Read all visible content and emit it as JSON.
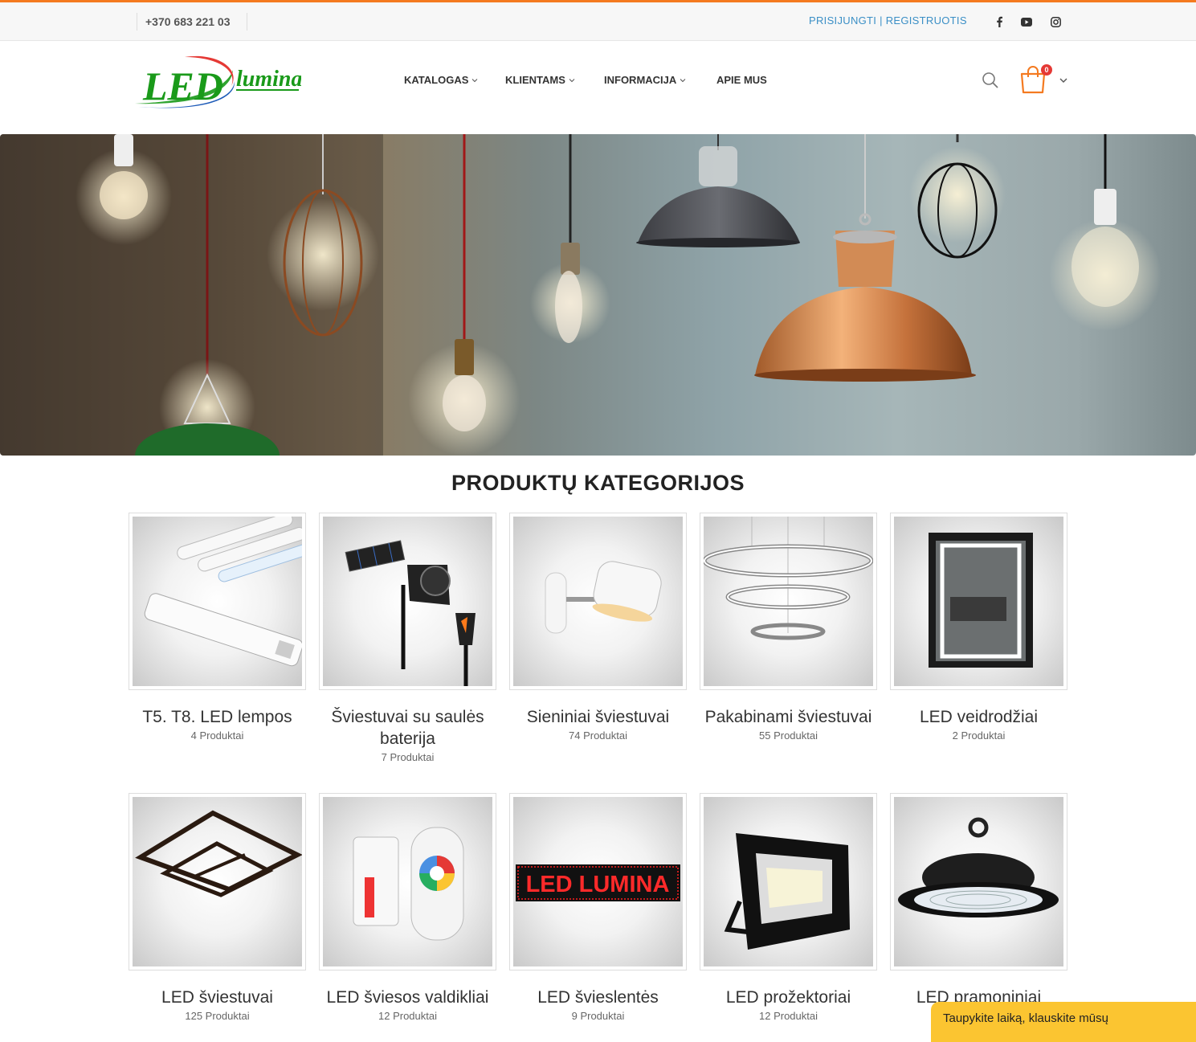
{
  "topbar": {
    "phone": "+370 683 221 03",
    "auth": "PRISIJUNGTI | REGISTRUOTIS",
    "social": [
      "facebook-icon",
      "youtube-icon",
      "instagram-icon"
    ]
  },
  "header": {
    "logo_text_led": "LED",
    "logo_text_lumina": "lumina",
    "nav": [
      {
        "label": "KATALOGAS",
        "has_dropdown": true
      },
      {
        "label": "KLIENTAMS",
        "has_dropdown": true
      },
      {
        "label": "INFORMACIJA",
        "has_dropdown": true
      },
      {
        "label": "APIE MUS",
        "has_dropdown": false
      }
    ],
    "cart_count": "0"
  },
  "section": {
    "title": "PRODUKTŲ KATEGORIJOS"
  },
  "categories": [
    {
      "name": "T5. T8. LED lempos",
      "count": "4 Produktai"
    },
    {
      "name": "Šviestuvai su saulės baterija",
      "count": "7 Produktai"
    },
    {
      "name": "Sieniniai šviestuvai",
      "count": "74 Produktai"
    },
    {
      "name": "Pakabinami šviestuvai",
      "count": "55 Produktai"
    },
    {
      "name": "LED veidrodžiai",
      "count": "2 Produktai"
    },
    {
      "name": "LED šviestuvai",
      "count": "125 Produktai"
    },
    {
      "name": "LED šviesos valdikliai",
      "count": "12 Produktai"
    },
    {
      "name": "LED švieslentės",
      "count": "9 Produktai"
    },
    {
      "name": "LED prožektoriai",
      "count": "12 Produktai"
    },
    {
      "name": "LED pramoniniai",
      "count": ""
    }
  ],
  "sign_text": "LED LUMINA",
  "chat": {
    "label": "Taupykite laiką, klauskite mūsų"
  },
  "colors": {
    "accent": "#f47a20",
    "link": "#3b8fc6",
    "badge": "#e53935",
    "chat": "#fbc531",
    "logo_green": "#1a9a1a"
  }
}
